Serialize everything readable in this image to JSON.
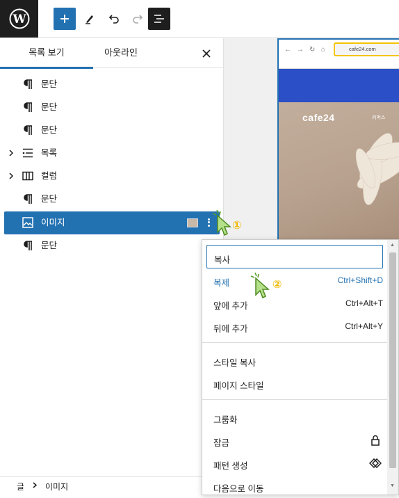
{
  "toolbar": {
    "logo_icon": "wordpress-logo",
    "add_icon": "plus-icon",
    "tools_icon": "pen-icon",
    "undo_icon": "undo-icon",
    "redo_icon": "redo-icon",
    "list_view_icon": "list-view-icon"
  },
  "panel": {
    "tab_list": "목록 보기",
    "tab_outline": "아웃라인",
    "close_icon": "close-icon",
    "items": [
      {
        "label": "문단",
        "icon": "paragraph-icon",
        "expandable": false
      },
      {
        "label": "문단",
        "icon": "paragraph-icon",
        "expandable": false
      },
      {
        "label": "문단",
        "icon": "paragraph-icon",
        "expandable": false
      },
      {
        "label": "목록",
        "icon": "list-icon",
        "expandable": true
      },
      {
        "label": "컬럼",
        "icon": "columns-icon",
        "expandable": true
      },
      {
        "label": "문단",
        "icon": "paragraph-icon",
        "expandable": false
      },
      {
        "label": "이미지",
        "icon": "image-icon",
        "expandable": false,
        "selected": true
      },
      {
        "label": "문단",
        "icon": "paragraph-icon",
        "expandable": false
      }
    ]
  },
  "breadcrumb": {
    "root": "글",
    "current": "이미지"
  },
  "preview": {
    "url": "cafe24.com",
    "brand": "cafe24",
    "brand_sub": "커머스"
  },
  "menu": {
    "group1": [
      {
        "label": "복사",
        "shortcut": ""
      },
      {
        "label": "복제",
        "shortcut": "Ctrl+Shift+D"
      },
      {
        "label": "앞에 추가",
        "shortcut": "Ctrl+Alt+T"
      },
      {
        "label": "뒤에 추가",
        "shortcut": "Ctrl+Alt+Y"
      }
    ],
    "group2": [
      {
        "label": "스타일 복사"
      },
      {
        "label": "페이지 스타일"
      }
    ],
    "group3": [
      {
        "label": "그룹화",
        "icon": ""
      },
      {
        "label": "잠금",
        "icon": "lock-icon"
      },
      {
        "label": "패턴 생성",
        "icon": "diamond-icon"
      },
      {
        "label": "다음으로 이동",
        "icon": ""
      }
    ]
  },
  "annotations": {
    "step1": "①",
    "step2": "②"
  },
  "colors": {
    "accent": "#2271b1",
    "highlight": "#f3c400",
    "cursor": "#b5e08a"
  }
}
